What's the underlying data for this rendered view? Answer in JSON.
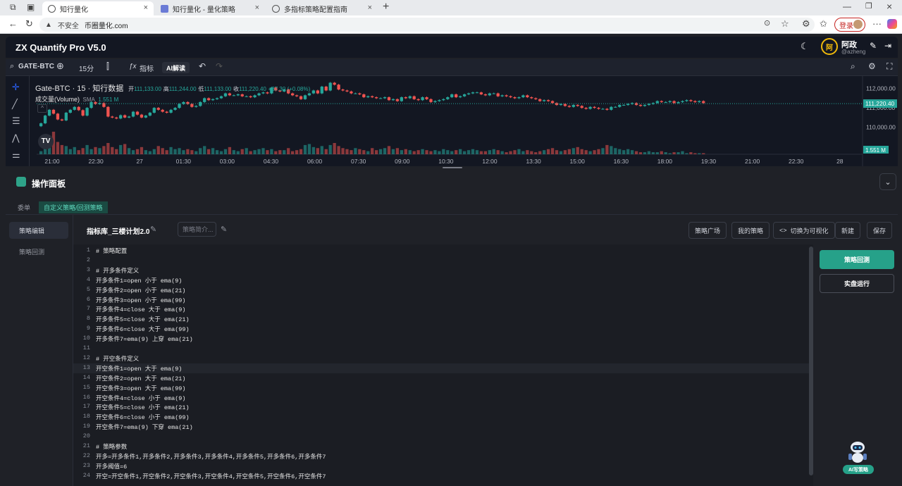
{
  "browser": {
    "tabs": [
      {
        "label": "知行量化",
        "active": true
      },
      {
        "label": "知行量化 - 量化策略",
        "active": false
      },
      {
        "label": "多指标策略配置指南",
        "active": false
      }
    ],
    "security_label": "不安全",
    "url": "币圈量化.com",
    "login_label": "登录"
  },
  "app": {
    "title": "ZX Quantify Pro V5.0",
    "user": {
      "avatar_char": "阿",
      "name": "阿政",
      "handle": "@azheng"
    }
  },
  "toolbar": {
    "symbol": "GATE-BTC",
    "interval": "15分",
    "indicator_label": "指标",
    "ai_label": "AI解读"
  },
  "chart_data": {
    "type": "candlestick",
    "symbol_line": "Gate-BTC · 15 · 知行数据",
    "ohlc": {
      "o_label": "开",
      "o": "111,133.00",
      "h_label": "高",
      "h": "111,244.00",
      "l_label": "低",
      "l": "111,133.00",
      "c_label": "收",
      "c": "111,220.40",
      "change": "+87.30 (+0.08%)"
    },
    "volume_label": "成交量(Volume)",
    "volume_ma_label": "SMA",
    "volume_ma_value": "1.551 M",
    "y_ticks": [
      112000,
      111000,
      110000
    ],
    "y_tick_labels": [
      "112,000.00",
      "111,000.00",
      "110,000.00"
    ],
    "ylim": [
      109000,
      112500
    ],
    "last_price_label": "111,220.40",
    "last_price": 111220.4,
    "last_volume_label": "1.551 M",
    "x_tick_labels": [
      "21:00",
      "22:30",
      "27",
      "01:30",
      "03:00",
      "04:30",
      "06:00",
      "07:30",
      "09:00",
      "10:30",
      "12:00",
      "13:30",
      "15:00",
      "16:30",
      "18:00",
      "19:30",
      "21:00",
      "22:30",
      "28"
    ],
    "closes": [
      110200,
      110600,
      110900,
      110700,
      110400,
      110350,
      110750,
      110900,
      111050,
      110880,
      110600,
      111000,
      111300,
      111200,
      111250,
      111050,
      110550,
      110500,
      110450,
      110620,
      110500,
      110550,
      110800,
      110650,
      110500,
      110600,
      110750,
      111000,
      110900,
      110800,
      110750,
      110900,
      111000,
      111200,
      111300,
      111200,
      111050,
      111100,
      111300,
      111500,
      111400,
      111450,
      111500,
      111600,
      111750,
      111650,
      111650,
      111700,
      111600,
      111600,
      111550,
      111650,
      111750,
      111800,
      111750,
      112050,
      111900,
      111850,
      111950,
      111750,
      111650,
      111600,
      111450,
      111650,
      111750,
      111900,
      111750,
      112100,
      111900,
      112300,
      112200,
      111950,
      111900,
      111850,
      111750,
      111750,
      111700,
      111550,
      111600,
      111550,
      111500,
      111500,
      111550,
      111400,
      111450,
      111350,
      111550,
      111500,
      111600,
      111450,
      111400,
      111550,
      111450,
      111300,
      111350,
      111400,
      111450,
      111550,
      111700,
      111550,
      111600,
      111700,
      111750,
      111800,
      111800,
      111700,
      111650,
      111750,
      111750,
      111600,
      111650,
      111600,
      111550,
      111500,
      111550,
      111650,
      111550,
      111500,
      111450,
      111350,
      111400,
      111350,
      111250,
      111150,
      111200,
      111100,
      111050,
      111150,
      111100,
      111000,
      110950,
      111050,
      111000,
      110950,
      110950,
      110900,
      111050,
      111050,
      111150,
      111150,
      111200,
      111250,
      111150,
      111100,
      111150,
      111200,
      111250,
      111350,
      111300,
      111300,
      111350,
      111250,
      111300,
      111350,
      111400,
      111350,
      111300,
      111350,
      111250
    ],
    "volumes": [
      0.3,
      0.9,
      1.4,
      2.2,
      1.2,
      0.9,
      0.8,
      0.5,
      0.7,
      0.4,
      0.6,
      0.9,
      0.5,
      0.7,
      0.6,
      0.8,
      1.1,
      0.7,
      0.5,
      0.9,
      1.0,
      0.6,
      0.4,
      0.5,
      0.7,
      0.4,
      0.3,
      0.5,
      0.8,
      0.6,
      0.4,
      0.7,
      0.5,
      0.6,
      0.4,
      0.5,
      0.4,
      0.3,
      0.6,
      0.8,
      0.5,
      0.6,
      0.4,
      0.3,
      0.5,
      0.7,
      0.4,
      0.3,
      0.5,
      0.6,
      0.3,
      0.4,
      0.5,
      0.6,
      0.4,
      0.5,
      0.3,
      0.4,
      0.4,
      0.6,
      0.3,
      0.4,
      0.5,
      0.9,
      1.0,
      0.7,
      0.6,
      0.8,
      0.5,
      0.9,
      1.1,
      0.8,
      0.6,
      0.5,
      0.4,
      0.6,
      0.5,
      0.4,
      0.3,
      0.6,
      0.4,
      0.5,
      0.6,
      0.8,
      0.5,
      0.6,
      0.4,
      0.5,
      0.4,
      0.3,
      0.4,
      0.5,
      0.4,
      0.3,
      0.4,
      0.3,
      0.5,
      0.4,
      0.3,
      0.4,
      0.5,
      0.3,
      0.4,
      0.5,
      0.4,
      0.3,
      0.3,
      0.4,
      0.5,
      0.4,
      0.3,
      0.2,
      0.3,
      0.4,
      0.5,
      0.3,
      0.4,
      0.3,
      0.2,
      0.3,
      0.4,
      0.5,
      0.6,
      0.4,
      0.3,
      0.4,
      0.5,
      0.6,
      0.7,
      0.5,
      0.4,
      0.3,
      0.4,
      0.5,
      0.6,
      0.9,
      0.8,
      0.6,
      0.5,
      0.4,
      0.5,
      0.4,
      0.3,
      0.2,
      0.2,
      0.3,
      0.2,
      0.2,
      0.3,
      0.2,
      0.1,
      0.2,
      0.2,
      0.3,
      0.1,
      0.2,
      0.1,
      0.1,
      0.1,
      0.1,
      0.1
    ],
    "up_color": "#26a69a",
    "down_color": "#ef5350"
  },
  "panel": {
    "title": "操作面板",
    "tabs": [
      {
        "label": "委单",
        "active": false
      },
      {
        "label": "自定义策略/回测策略",
        "active": true
      }
    ],
    "sidenav": [
      {
        "label": "策略编辑",
        "active": true
      },
      {
        "label": "策略回测",
        "active": false
      }
    ],
    "strategy_name": "指标库_三楼计划2.0",
    "desc_placeholder": "策略简介...",
    "buttons": {
      "square": "策略广场",
      "mine": "我的策略",
      "visual": "切换为可视化",
      "new": "新建",
      "save": "保存"
    },
    "run_backtest": "策略回测",
    "live_run": "实盘运行",
    "ai_badge": "AI写策略"
  },
  "editor": {
    "lines": [
      "# 策略配置",
      "",
      "# 开多条件定义",
      "开多条件1=open 小于 ema(9)",
      "开多条件2=open 小于 ema(21)",
      "开多条件3=open 小于 ema(99)",
      "开多条件4=close 大于 ema(9)",
      "开多条件5=close 大于 ema(21)",
      "开多条件6=close 大于 ema(99)",
      "开多条件7=ema(9) 上穿 ema(21)",
      "",
      "# 开空条件定义",
      "开空条件1=open 大于 ema(9)",
      "开空条件2=open 大于 ema(21)",
      "开空条件3=open 大于 ema(99)",
      "开空条件4=close 小于 ema(9)",
      "开空条件5=close 小于 ema(21)",
      "开空条件6=close 小于 ema(99)",
      "开空条件7=ema(9) 下穿 ema(21)",
      "",
      "# 策略参数",
      "开多=开多条件1,开多条件2,开多条件3,开多条件4,开多条件5,开多条件6,开多条件7",
      "开多阈值=6",
      "开空=开空条件1,开空条件2,开空条件3,开空条件4,开空条件5,开空条件6,开空条件7"
    ],
    "current_line": 13
  },
  "colors": {
    "accent": "#26a189",
    "brand_bg": "#131722",
    "danger": "#c5221f"
  }
}
